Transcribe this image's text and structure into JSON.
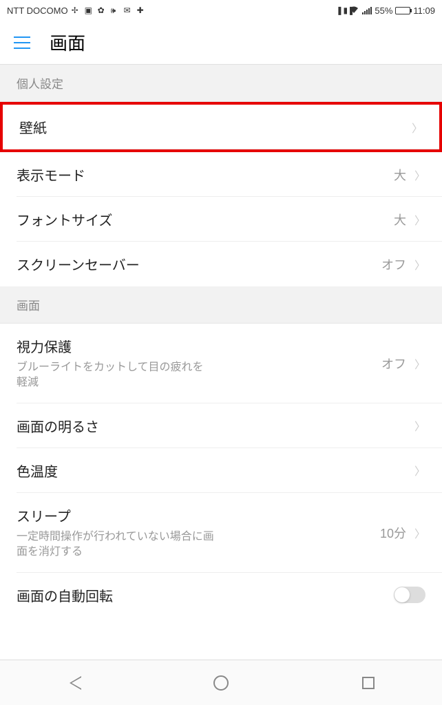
{
  "status": {
    "carrier": "NTT DOCOMO",
    "battery_pct": "55%",
    "time": "11:09"
  },
  "header": {
    "title": "画面"
  },
  "sections": [
    {
      "header": "個人設定",
      "items": [
        {
          "label": "壁紙",
          "value": "",
          "highlighted": true,
          "chevron": true
        },
        {
          "label": "表示モード",
          "value": "大",
          "chevron": true
        },
        {
          "label": "フォントサイズ",
          "value": "大",
          "chevron": true
        },
        {
          "label": "スクリーンセーバー",
          "value": "オフ",
          "chevron": true
        }
      ]
    },
    {
      "header": "画面",
      "items": [
        {
          "label": "視力保護",
          "desc": "ブルーライトをカットして目の疲れを軽減",
          "value": "オフ",
          "chevron": true
        },
        {
          "label": "画面の明るさ",
          "value": "",
          "chevron": true
        },
        {
          "label": "色温度",
          "value": "",
          "chevron": true
        },
        {
          "label": "スリープ",
          "desc": "一定時間操作が行われていない場合に画面を消灯する",
          "value": "10分",
          "chevron": true
        },
        {
          "label": "画面の自動回転",
          "value": "",
          "toggle": true
        }
      ]
    }
  ]
}
